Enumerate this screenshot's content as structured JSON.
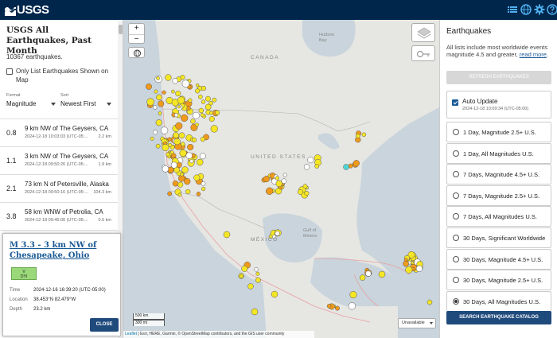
{
  "header": {
    "logo_text": "USGS",
    "colors": {
      "bar": "#00264c",
      "icon": "#4fb0f0"
    },
    "icons": [
      "list-icon",
      "globe-icon",
      "gear-icon",
      "help-icon"
    ]
  },
  "list_panel": {
    "title": "USGS All Earthquakes, Past Month",
    "count_text": "10367 earthquakes.",
    "only_list_label": "Only List Earthquakes Shown on Map",
    "format_label": "Format",
    "format_value": "Magnitude",
    "sort_label": "Sort",
    "sort_value": "Newest First",
    "earthquakes": [
      {
        "mag": "0.8",
        "place": "9 km NW of The Geysers, CA",
        "time": "2024-12-18 10:03:03 (UTC-05:...",
        "depth": "2.2 km"
      },
      {
        "mag": "1.1",
        "place": "3 km NW of The Geysers, CA",
        "time": "2024-12-18 09:50:26 (UTC-05:...",
        "depth": "1.9 km"
      },
      {
        "mag": "2.1",
        "place": "73 km N of Petersville, Alaska",
        "time": "2024-12-18 09:50:16 (UTC-05:...",
        "depth": "104.3 km"
      },
      {
        "mag": "3.8",
        "place": "58 km WNW of Petrolia, CA",
        "time": "2024-12-18 09:45:00 (UTC-05:...",
        "depth": "0.5 km"
      }
    ]
  },
  "map": {
    "zoom_in": "+",
    "zoom_out": "−",
    "labels": {
      "canada": "CANADA",
      "united_states": "UNITED STATES",
      "mexico": "MÉXICO",
      "gulf": "Gulf of Mexico",
      "hudson": "Hudson Bay"
    },
    "scale_km": "500 km",
    "scale_mi": "300 mi",
    "unavailable": "Unavailable",
    "attribution_leaflet": "Leaflet",
    "attribution_rest": " | Esri, HERE, Garmin, © OpenStreetMap contributors, and the GIS user community",
    "colors": {
      "land": "#e6e6e3",
      "water": "#c9d4dc",
      "plate": "#e8a0a0",
      "quake_yellow": "#f5e625",
      "quake_orange": "#f09a1c",
      "quake_recent": "#4dd8d8"
    }
  },
  "popup": {
    "title": "M 3.3 - 3 km NW of Chesapeake, Ohio",
    "mmi_label": "V",
    "mmi_sub": "DYI",
    "time_label": "Time",
    "time_value": "2024-12-16 16:39:20 (UTC-05:00)",
    "location_label": "Location",
    "location_value": "38.453°N 82.479°W",
    "depth_label": "Depth",
    "depth_value": "23.2 km",
    "close": "CLOSE"
  },
  "right_panel": {
    "title": "Earthquakes",
    "description": "All lists include most worldwide events magnitude 4.5 and greater,",
    "read_more": "read more",
    "refresh": "REFRESH EARTHQUAKES",
    "auto_update_label": "Auto Update",
    "auto_update_time": "2024-12-18 10:09:34 (UTC-05:00)",
    "feeds": [
      {
        "label": "1 Day, Magnitude 2.5+ U.S.",
        "selected": false
      },
      {
        "label": "1 Day, All Magnitudes U.S.",
        "selected": false
      },
      {
        "label": "7 Days, Magnitude 4.5+ U.S.",
        "selected": false
      },
      {
        "label": "7 Days, Magnitude 2.5+ U.S.",
        "selected": false
      },
      {
        "label": "7 Days, All Magnitudes U.S.",
        "selected": false
      },
      {
        "label": "30 Days, Significant Worldwide",
        "selected": false
      },
      {
        "label": "30 Days, Magnitude 4.5+ U.S.",
        "selected": false
      },
      {
        "label": "30 Days, Magnitude 2.5+ U.S.",
        "selected": false
      },
      {
        "label": "30 Days, All Magnitudes U.S.",
        "selected": true
      }
    ],
    "search": "SEARCH EARTHQUAKE CATALOG"
  }
}
